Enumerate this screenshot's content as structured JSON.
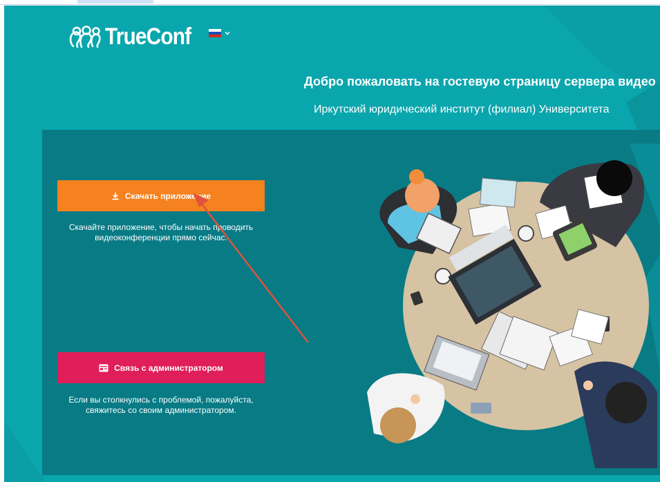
{
  "header": {
    "logo_text": "TrueConf",
    "language": {
      "flag_colors": [
        "#ffffff",
        "#1d4fb8",
        "#d52b1e"
      ]
    }
  },
  "welcome": {
    "title": "Добро пожаловать на гостевую страницу сервера видео",
    "organization": "Иркутский юридический институт (филиал) Университета"
  },
  "download": {
    "button_label": "Скачать приложение",
    "description": "Скачайте приложение, чтобы начать проводить видеоконференции прямо сейчас."
  },
  "admin": {
    "button_label": "Связь с администратором",
    "description": "Если вы столкнулись с проблемой, пожалуйста, свяжитесь со своим администратором."
  },
  "colors": {
    "page_bg": "#0aa6ad",
    "panel_bg": "#087b85",
    "download_button": "#f5821f",
    "admin_button": "#e01e5a",
    "arrow": "#e0533d"
  },
  "icons": {
    "logo": "trueconf-people-icon",
    "language_chevron": "chevron-down-icon",
    "download": "download-icon",
    "admin": "contact-card-icon"
  }
}
